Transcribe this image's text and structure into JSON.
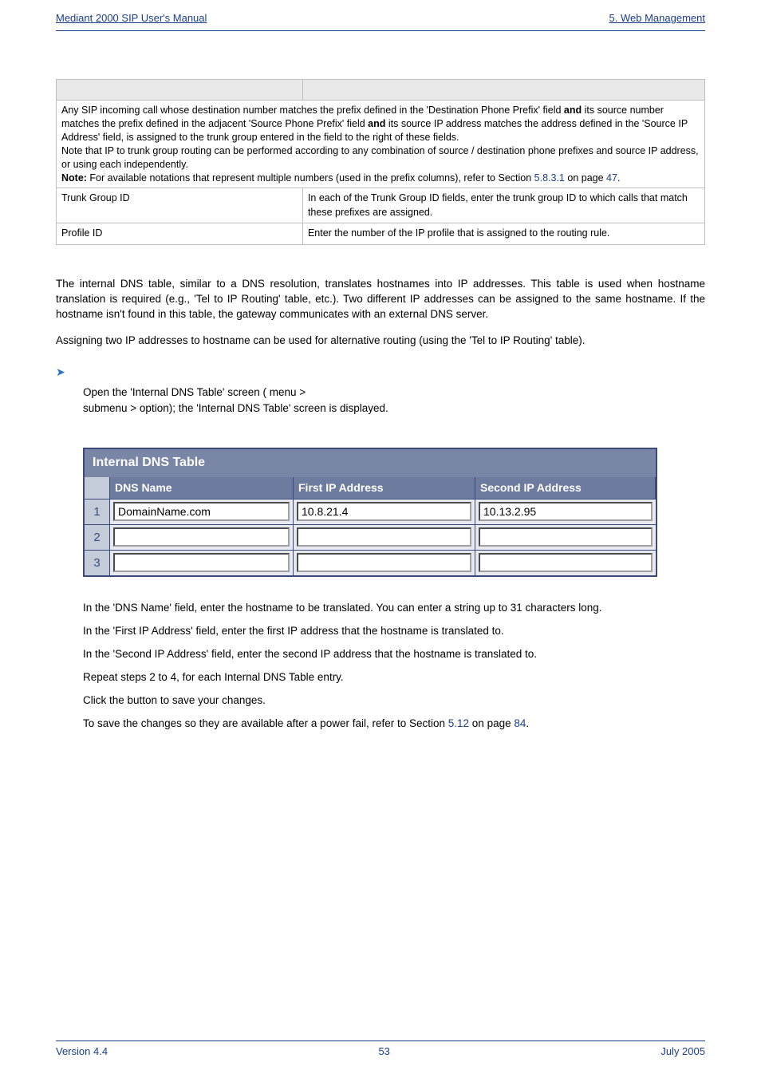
{
  "header": {
    "left": "Mediant 2000 SIP User's Manual",
    "right": "5. Web Management"
  },
  "table1": {
    "spanText": "Any SIP incoming call whose destination number matches the prefix defined in the 'Destination Phone Prefix' field ",
    "spanBold1": "and",
    "spanText2": " its source number matches the prefix defined in the adjacent 'Source Phone Prefix' field ",
    "spanBold2": "and",
    "spanText3": " its source IP address matches the address defined in the 'Source IP Address' field, is assigned to the trunk group entered in the field to the right of these fields.",
    "note1": "Note that IP to trunk group routing can be performed according to any combination of source / destination phone prefixes and source IP address, or using each independently.",
    "note2a": "Note: ",
    "note2b": "For available notations that represent multiple numbers (used in the prefix columns), refer to Section ",
    "note2_link": "5.8.3.1",
    "note2c": " on page ",
    "note2_page": "47",
    "note2d": ".",
    "row1_label": "Trunk Group ID",
    "row1_value": "In each of the Trunk Group ID fields, enter the trunk group ID to which calls that match these prefixes are assigned.",
    "row2_label": "Profile ID",
    "row2_value": "Enter the number of the IP profile that is assigned to the routing rule."
  },
  "para1": "The internal DNS table, similar to a DNS resolution, translates hostnames into IP addresses. This table is used when hostname translation is required (e.g., 'Tel to IP Routing' table, etc.). Two different IP addresses can be assigned to the same hostname. If the hostname isn't found in this table, the gateway communicates with an external DNS server.",
  "para2": "Assigning two IP addresses to hostname can be used for alternative routing (using the 'Tel to IP Routing' table).",
  "stepLine1a": "Open the 'Internal DNS Table' screen (",
  "stepLine1b": " menu > ",
  "stepLine1c": " submenu > ",
  "stepLine1d": " option); the 'Internal DNS Table' screen is displayed.",
  "dns": {
    "title": "Internal DNS Table",
    "col1": "DNS Name",
    "col2": "First IP Address",
    "col3": "Second IP Address",
    "rows": [
      {
        "num": "1",
        "name": "DomainName.com",
        "ip1": "10.8.21.4",
        "ip2": "10.13.2.95"
      },
      {
        "num": "2",
        "name": "",
        "ip1": "",
        "ip2": ""
      },
      {
        "num": "3",
        "name": "",
        "ip1": "",
        "ip2": ""
      }
    ]
  },
  "steps": {
    "s2": "In the 'DNS Name' field, enter the hostname to be translated. You can enter a string up to 31 characters long.",
    "s3": "In the 'First IP Address' field, enter the first IP address that the hostname is translated to.",
    "s4": "In the 'Second IP Address' field, enter the second IP address that the hostname is translated to.",
    "s5": "Repeat steps 2 to 4, for each Internal DNS Table entry.",
    "s6a": "Click the ",
    "s6b": " button to save your changes.",
    "s7a": "To save the changes so they are available after a power fail, refer to Section ",
    "s7_link1": "5.12",
    "s7b": " on page ",
    "s7_link2": "84",
    "s7c": "."
  },
  "footer": {
    "left": "Version 4.4",
    "center": "53",
    "right": "July 2005"
  }
}
